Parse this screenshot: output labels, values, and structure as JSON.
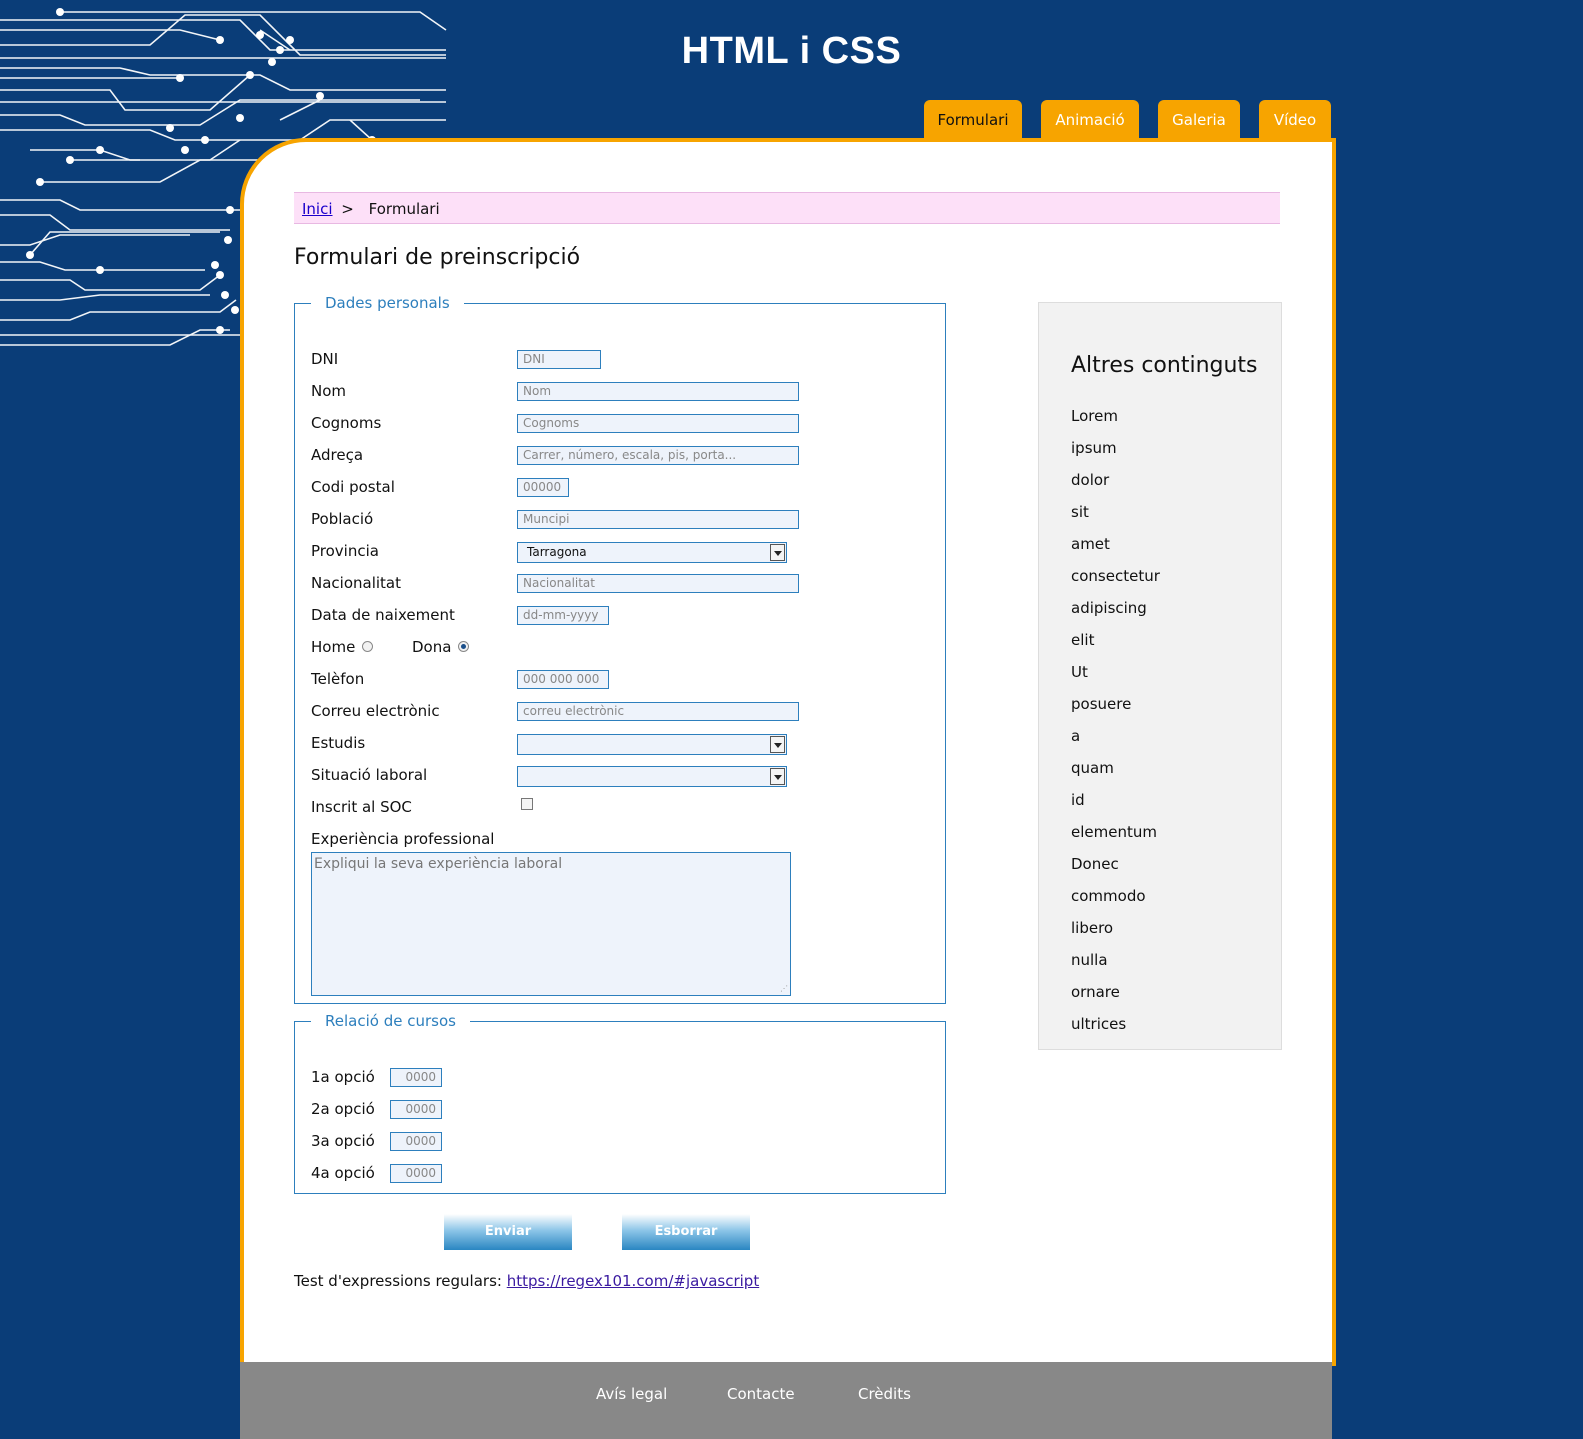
{
  "site": {
    "title": "HTML i CSS"
  },
  "nav": {
    "tabs": [
      {
        "label": "Formulari",
        "active": true
      },
      {
        "label": "Animació",
        "active": false
      },
      {
        "label": "Galeria",
        "active": false
      },
      {
        "label": "Vídeo",
        "active": false
      }
    ]
  },
  "colors": {
    "background": "#0a3d78",
    "accent": "#f7a400",
    "link": "#1a00cc",
    "fieldset": "#2d7fbd"
  },
  "breadcrumb": {
    "home": "Inici",
    "separator": ">",
    "current": "Formulari"
  },
  "page_title": "Formulari de preinscripció",
  "personal": {
    "legend": "Dades personals",
    "fields": {
      "dni": {
        "label": "DNI",
        "placeholder": "DNI"
      },
      "nom": {
        "label": "Nom",
        "placeholder": "Nom"
      },
      "cognoms": {
        "label": "Cognoms",
        "placeholder": "Cognoms"
      },
      "adreca": {
        "label": "Adreça",
        "placeholder": "Carrer, número, escala, pis, porta..."
      },
      "codi_postal": {
        "label": "Codi postal",
        "placeholder": "00000"
      },
      "poblacio": {
        "label": "Població",
        "placeholder": "Muncipi"
      },
      "provincia": {
        "label": "Provincia",
        "value": "Tarragona"
      },
      "nacionalitat": {
        "label": "Nacionalitat",
        "placeholder": "Nacionalitat"
      },
      "data_naixement": {
        "label": "Data de naixement",
        "placeholder": "dd-mm-yyyy"
      },
      "home": {
        "label": "Home",
        "checked": false
      },
      "dona": {
        "label": "Dona",
        "checked": true
      },
      "telefon": {
        "label": "Telèfon",
        "placeholder": "000 000 000"
      },
      "correu": {
        "label": "Correu electrònic",
        "placeholder": "correu electrònic"
      },
      "estudis": {
        "label": "Estudis",
        "value": ""
      },
      "situacio": {
        "label": "Situació laboral",
        "value": ""
      },
      "soc": {
        "label": "Inscrit al SOC",
        "checked": false
      },
      "experiencia": {
        "label": "Experiència professional",
        "placeholder": "Expliqui la seva experiència laboral"
      }
    }
  },
  "cursos": {
    "legend": "Relació de cursos",
    "options": [
      {
        "label": "1a opció",
        "placeholder": "0000"
      },
      {
        "label": "2a opció",
        "placeholder": "0000"
      },
      {
        "label": "3a opció",
        "placeholder": "0000"
      },
      {
        "label": "4a opció",
        "placeholder": "0000"
      }
    ]
  },
  "buttons": {
    "submit": "Enviar",
    "reset": "Esborrar"
  },
  "regex": {
    "text": "Test d'expressions regulars:",
    "link": "https://regex101.com/#javascript"
  },
  "sidebar": {
    "title": "Altres continguts",
    "items": [
      "Lorem",
      "ipsum",
      "dolor",
      "sit",
      "amet",
      "consectetur",
      "adipiscing",
      "elit",
      "Ut",
      "posuere",
      "a",
      "quam",
      "id",
      "elementum",
      "Donec",
      "commodo",
      "libero",
      "nulla",
      "ornare",
      "ultrices"
    ]
  },
  "footer": {
    "links": [
      "Avís legal",
      "Contacte",
      "Crèdits"
    ]
  }
}
